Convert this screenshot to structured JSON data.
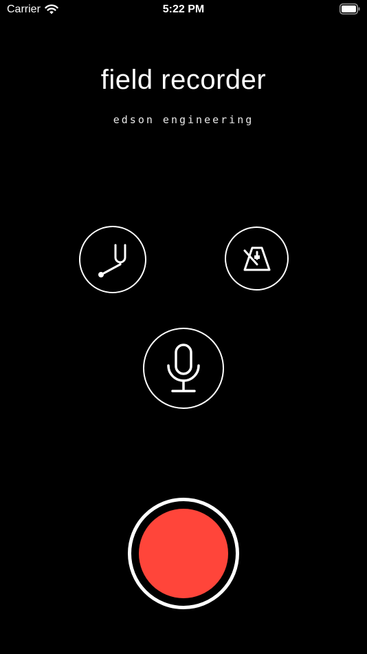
{
  "status_bar": {
    "carrier": "Carrier",
    "time": "5:22 PM"
  },
  "app": {
    "title": "field recorder",
    "subtitle": "edson engineering"
  },
  "buttons": {
    "tuner_icon": "tuning-fork-icon",
    "metronome_icon": "metronome-icon",
    "mic_icon": "microphone-icon",
    "record_icon": "record-icon"
  },
  "colors": {
    "background": "#000000",
    "foreground": "#ffffff",
    "record": "#ff453a"
  }
}
